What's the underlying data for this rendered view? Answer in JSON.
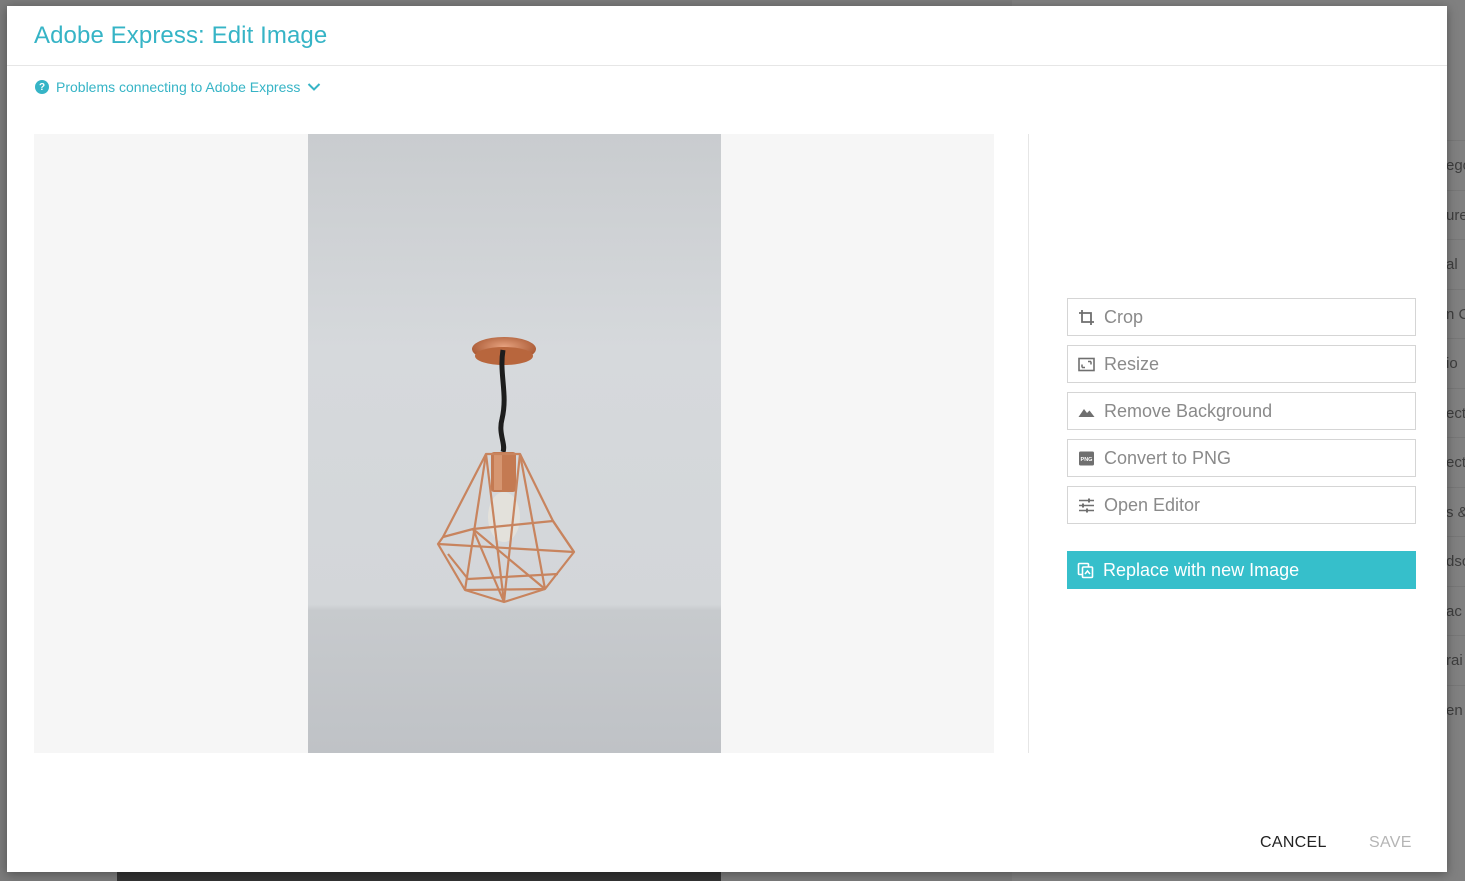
{
  "dialog": {
    "title": "Adobe Express: Edit Image",
    "help_link": "Problems connecting to Adobe Express",
    "help_icon": "question-circle-icon",
    "help_chevron_icon": "chevron-down-icon"
  },
  "preview": {
    "image_subject": "copper geometric pendant lamp"
  },
  "tools": [
    {
      "label": "Crop",
      "icon": "crop-icon"
    },
    {
      "label": "Resize",
      "icon": "resize-icon"
    },
    {
      "label": "Remove Background",
      "icon": "mountain-icon"
    },
    {
      "label": "Convert to PNG",
      "icon": "png-file-icon"
    },
    {
      "label": "Open Editor",
      "icon": "sliders-icon"
    }
  ],
  "replace": {
    "label": "Replace with new Image",
    "icon": "replace-image-icon"
  },
  "footer": {
    "cancel_label": "CANCEL",
    "save_label": "SAVE"
  },
  "background": {
    "right_rows": [
      "ego",
      "ure",
      "al",
      "n C",
      "io",
      "ect",
      "ect",
      "s &",
      "dsc",
      "ac",
      "rai",
      "en"
    ]
  },
  "colors": {
    "accent": "#36b4c6",
    "button_fill": "#36bfcb",
    "disabled": "#b5b5b5"
  }
}
